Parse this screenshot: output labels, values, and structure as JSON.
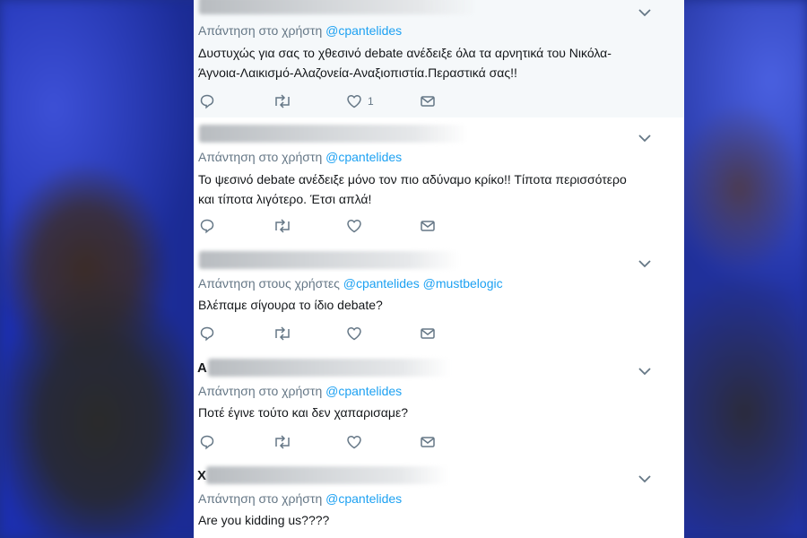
{
  "colors": {
    "link": "#1da1f2",
    "meta": "#657786",
    "text": "#14171a"
  },
  "tweets": [
    {
      "initial": "",
      "reply_prefix": "Απάντηση στο χρήστη",
      "handles": [
        "@cpantelides"
      ],
      "text_lines": [
        "Δυστυχώς για σας το χθεσινό debate ανέδειξε όλα τα αρνητικά του Νικόλα-",
        "Άγνοια-Λαικισμό-Αλαζονεία-Αναξιοπιστία.Περαστικά σας!!"
      ],
      "like_count": "1"
    },
    {
      "initial": "",
      "reply_prefix": "Απάντηση στο χρήστη",
      "handles": [
        "@cpantelides"
      ],
      "text_lines": [
        "Το ψεσινό debate ανέδειξε μόνο τον πιο αδύναμο κρίκο!! Τίποτα περισσότερο",
        "και τίποτα λιγότερο. Έτσι απλά!"
      ],
      "like_count": ""
    },
    {
      "initial": "",
      "reply_prefix": "Απάντηση στους χρήστες",
      "handles": [
        "@cpantelides",
        "@mustbelogic"
      ],
      "text_lines": [
        "Βλέπαμε σίγουρα το ίδιο debate?"
      ],
      "like_count": ""
    },
    {
      "initial": "A",
      "reply_prefix": "Απάντηση στο χρήστη",
      "handles": [
        "@cpantelides"
      ],
      "text_lines": [
        "Ποτέ έγινε τούτο και δεν χαπαρισαμε?"
      ],
      "like_count": ""
    },
    {
      "initial": "X",
      "reply_prefix": "Απάντηση στο χρήστη",
      "handles": [
        "@cpantelides"
      ],
      "text_lines": [
        "Are you kidding us????"
      ],
      "like_count": ""
    }
  ],
  "icons": {
    "more": "chevron-down-icon",
    "reply": "reply-icon",
    "retweet": "retweet-icon",
    "like": "heart-icon",
    "dm": "envelope-icon"
  }
}
